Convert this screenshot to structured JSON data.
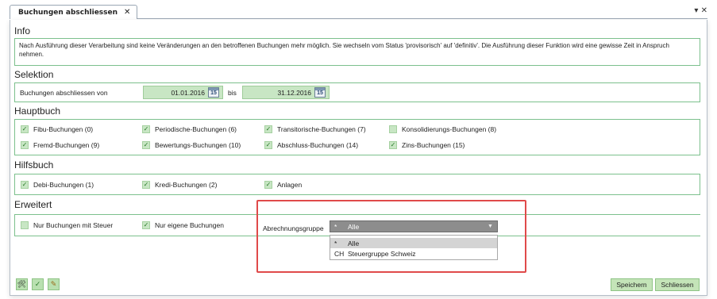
{
  "tab": {
    "title": "Buchungen abschliessen",
    "close_glyph": "✕"
  },
  "window_controls": {
    "glyph": "▾ ✕"
  },
  "info": {
    "title": "Info",
    "text": "Nach Ausführung dieser Verarbeitung sind keine Veränderungen an den betroffenen Buchungen mehr möglich. Sie wechseln vom Status 'provisorisch' auf 'definitiv'. Die Ausführung dieser Funktion wird eine gewisse Zeit in Anspruch nehmen."
  },
  "selektion": {
    "title": "Selektion",
    "label": "Buchungen abschliessen von",
    "date_from": "01.01.2016",
    "between": "bis",
    "date_to": "31.12.2016",
    "calendar_glyph": "15"
  },
  "hauptbuch": {
    "title": "Hauptbuch",
    "items": [
      {
        "label": "Fibu-Buchungen (0)",
        "checked": "✓"
      },
      {
        "label": "Periodische-Buchungen (6)",
        "checked": "✓"
      },
      {
        "label": "Transitorische-Buchungen (7)",
        "checked": "✓"
      },
      {
        "label": "Konsolidierungs-Buchungen (8)",
        "checked": ""
      },
      {
        "label": "Fremd-Buchungen (9)",
        "checked": "✓"
      },
      {
        "label": "Bewertungs-Buchungen (10)",
        "checked": "✓"
      },
      {
        "label": "Abschluss-Buchungen (14)",
        "checked": "✓"
      },
      {
        "label": "Zins-Buchungen (15)",
        "checked": "✓"
      }
    ]
  },
  "hilfsbuch": {
    "title": "Hilfsbuch",
    "items": [
      {
        "label": "Debi-Buchungen (1)",
        "checked": "✓"
      },
      {
        "label": "Kredi-Buchungen (2)",
        "checked": "✓"
      },
      {
        "label": "Anlagen",
        "checked": "✓"
      }
    ]
  },
  "erweitert": {
    "title": "Erweitert",
    "items": [
      {
        "label": "Nur Buchungen mit Steuer",
        "checked": ""
      },
      {
        "label": "Nur eigene Buchungen",
        "checked": "✓"
      }
    ],
    "group_label": "Abrechnungsgruppe",
    "selected": {
      "code": "*",
      "value": "Alle"
    },
    "arrow_glyph": "▼",
    "options": [
      {
        "code": "*",
        "value": "Alle"
      },
      {
        "code": "CH",
        "value": "Steuergruppe Schweiz"
      }
    ]
  },
  "toolbar": {
    "icons": [
      "🛠",
      "✓",
      "✎"
    ]
  },
  "actions": {
    "save": "Speichern",
    "close": "Schliessen"
  },
  "colors": {
    "section_border": "#7cc08d",
    "field_bg": "#c8e6c4",
    "highlight": "#e04a4a"
  }
}
